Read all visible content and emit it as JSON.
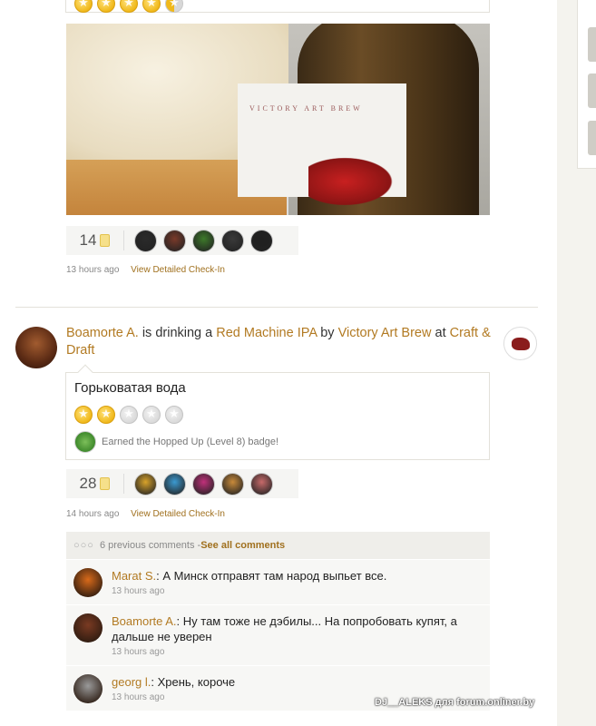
{
  "previous_checkin": {
    "rating": [
      "full",
      "full",
      "full",
      "full",
      "half"
    ],
    "toast_count": "14",
    "toasters": [
      "#2b2b2b",
      "#7a3a2a",
      "#3d7a2a",
      "#3a3a3a",
      "#1f1f1f"
    ],
    "time": "13 hours ago",
    "detail_link": "View Detailed Check-In",
    "photo_label_text": "VICTORY ART BREW"
  },
  "checkin": {
    "user": "Boamorte A.",
    "text_drinking": "is drinking a",
    "beer": "Red Machine IPA",
    "text_by": "by",
    "brewery": "Victory Art Brew",
    "text_at": "at",
    "venue": "Craft & Draft",
    "comment": "Горьковатая вода",
    "rating": [
      "full",
      "full",
      "empty",
      "empty",
      "empty"
    ],
    "badge_text": "Earned the Hopped Up (Level 8) badge!",
    "toast_count": "28",
    "toasters": [
      "#d8a32a",
      "#3b9ad1",
      "#c0307a",
      "#c88a3a",
      "#c76a6a"
    ],
    "time": "14 hours ago",
    "detail_link": "View Detailed Check-In"
  },
  "comments": {
    "dots": "○○○",
    "previous_count": "6 previous comments - ",
    "see_all": "See all comments",
    "items": [
      {
        "user": "Marat S.",
        "text": ": А Минск отправят там народ выпьет все.",
        "time": "13 hours ago",
        "avatar_color": "#d86a1a"
      },
      {
        "user": "Boamorte A.",
        "text": ": Ну там тоже не дэбилы... На попробовать купят, а дальше не уверен",
        "time": "13 hours ago",
        "avatar_color": "#7a3a22"
      },
      {
        "user": "georg l.",
        "text": ": Хрень, короче",
        "time": "13 hours ago",
        "avatar_color": "#9a9a9a"
      }
    ]
  },
  "watermark": "DJ__ALEKS для forum.onliner.by"
}
